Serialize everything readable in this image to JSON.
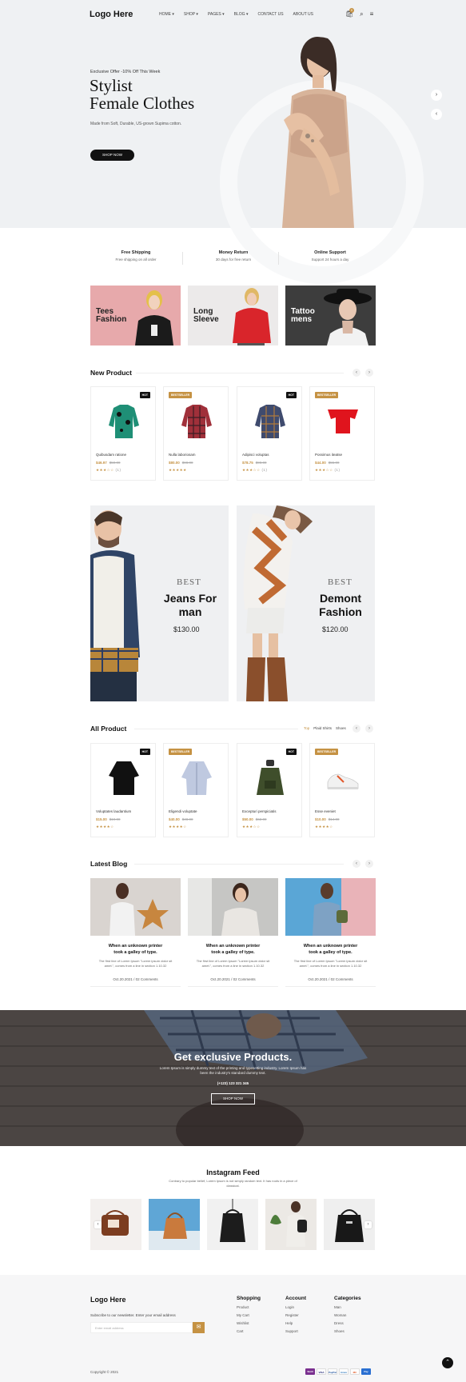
{
  "header": {
    "logo": "Logo Here",
    "nav": [
      "HOME",
      "SHOP",
      "PAGES",
      "BLOG",
      "CONTACT US",
      "ABOUT US"
    ],
    "cart_count": "0"
  },
  "hero": {
    "offer": "Exclusive Offer -10% Off This Week",
    "title_line1": "Stylist",
    "title_line2": "Female Clothes",
    "subtitle": "Made from Soft, Durable, US-grown Supima cotton.",
    "button": "SHOP NOW"
  },
  "features": [
    {
      "title": "Free Shipping",
      "text": "Free shipping on all order"
    },
    {
      "title": "Money Return",
      "text": "30 days for free return"
    },
    {
      "title": "Online Support",
      "text": "Support 24 hours a day"
    }
  ],
  "categories": [
    {
      "label": "Tees Fashion"
    },
    {
      "label": "Long Sleeve"
    },
    {
      "label": "Tattoo mens"
    }
  ],
  "new_product": {
    "title": "New Product",
    "items": [
      {
        "name": "Quibusdam ratione",
        "price": "$46.97",
        "old": "$59.00",
        "badge": "HOT",
        "stars": "★★★☆☆",
        "reviews": "(1)"
      },
      {
        "name": "Nulla laboriosam",
        "price": "$80.00",
        "old": "$98.00",
        "badge": "BESTSELLER",
        "stars": "★★★★★",
        "reviews": ""
      },
      {
        "name": "Adipisci voluptas",
        "price": "$78.75",
        "old": "$98.00",
        "badge": "HOT",
        "stars": "★★★☆☆",
        "reviews": "(1)"
      },
      {
        "name": "Possimus iteatse",
        "price": "$44.00",
        "old": "$55.00",
        "badge": "BESTSELLER",
        "stars": "★★★☆☆",
        "reviews": "(1)"
      }
    ]
  },
  "banners": [
    {
      "best": "BEST",
      "title": "Jeans For man",
      "price": "$130.00"
    },
    {
      "best": "BEST",
      "title": "Demont Fashion",
      "price": "$120.00"
    }
  ],
  "all_product": {
    "title": "All Product",
    "tabs": [
      "Top",
      "Plaid Shirts",
      "Shoes"
    ],
    "items": [
      {
        "name": "Voluptates laudantium",
        "price": "$15.00",
        "old": "$19.00",
        "badge": "HOT",
        "stars": "★★★★☆",
        "reviews": ""
      },
      {
        "name": "Eligendi voluptate",
        "price": "$40.00",
        "old": "$48.00",
        "badge": "BESTSELLER",
        "stars": "★★★★☆",
        "reviews": ""
      },
      {
        "name": "Excepturi perspiciatis",
        "price": "$50.00",
        "old": "$62.00",
        "badge": "HOT",
        "stars": "★★★☆☆",
        "reviews": ""
      },
      {
        "name": "Esse eveniet",
        "price": "$10.00",
        "old": "$14.00",
        "badge": "BESTSELLER",
        "stars": "★★★★☆",
        "reviews": ""
      }
    ]
  },
  "blog": {
    "title": "Latest Blog",
    "posts": [
      {
        "title": "When an unknown printer took a galley of type.",
        "text": "The first line of Lorem Ipsum \"Lorem ipsum dolor sit amet.\", comes from a line in section 1.10.32",
        "date": "Oct.20.2021",
        "comments": "/ 02 Comments"
      },
      {
        "title": "When an unknown printer took a galley of type.",
        "text": "The first line of Lorem Ipsum \"Lorem ipsum dolor sit amet.\", comes from a line in section 1.10.32",
        "date": "Oct.20.2021",
        "comments": "/ 02 Comments"
      },
      {
        "title": "When an unknown printer took a galley of type.",
        "text": "The first line of Lorem Ipsum \"Lorem ipsum dolor sit amet.\", comes from a line in section 1.10.32",
        "date": "Oct.20.2021",
        "comments": "/ 02 Comments"
      }
    ]
  },
  "exclusive": {
    "title": "Get exclusive Products.",
    "text": "Lorem Ipsum is simply dummy text of the printing and typesetting industry. Lorem Ipsum has been the industry's standard dummy text.",
    "phone": "(+123) 123 321 345",
    "button": "SHOP NOW"
  },
  "instagram": {
    "title": "Instagram Feed",
    "text": "Contrary to popular belief, Lorem Ipsum is not simply random text. It has roots in a piece of classical."
  },
  "footer": {
    "logo": "Logo Here",
    "subscribe": "Subscribe to our newsletter. Enter your email address",
    "placeholder": "Enter email address",
    "columns": [
      {
        "title": "Shopping",
        "links": [
          "Product",
          "My Cart",
          "Wishlist",
          "Cart"
        ]
      },
      {
        "title": "Account",
        "links": [
          "Login",
          "Register",
          "Help",
          "Support"
        ]
      },
      {
        "title": "Categories",
        "links": [
          "Man",
          "Woman",
          "Dress",
          "Shoes"
        ]
      }
    ],
    "copyright": "Copyright © 2021",
    "payments": [
      "Skrill",
      "VISA",
      "PayPal",
      "Amex",
      "MC",
      "Pay"
    ]
  },
  "colors": {
    "accent": "#c59243",
    "dark": "#111111",
    "hero_bg": "#eff1f3",
    "footer_bg": "#f6f6f7"
  }
}
